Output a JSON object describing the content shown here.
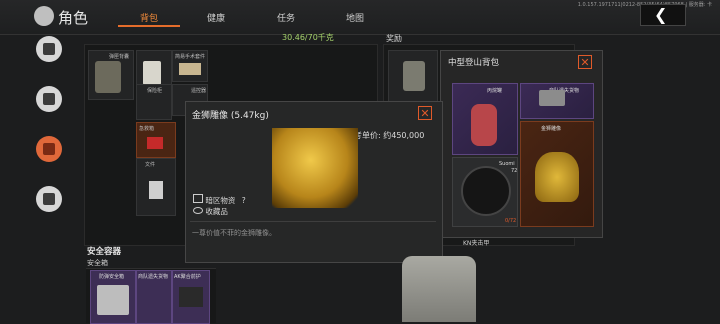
{
  "header": {
    "build": "1.0.157.1971711|0212-852|35(64)857968 | 服务器: 卡",
    "title": "角色",
    "tabs": [
      "背包",
      "健康",
      "任务",
      "地图"
    ],
    "active_tab": "背包"
  },
  "inventory": {
    "weight": "30.46/70千克",
    "items": [
      "弹匣背囊",
      "简易手术套件",
      "保险柜",
      "遥控器",
      "急救箱",
      "红色文件",
      "文件"
    ]
  },
  "reward": {
    "title": "奖励"
  },
  "bag_panel": {
    "title": "中型登山背包",
    "items": [
      "丙烷罐",
      "商队遗失货物",
      "Suomi",
      "金狮雕像"
    ],
    "suomi_sub": "72",
    "ammo": "0/72"
  },
  "popup": {
    "title": "金狮雕像 (5.47kg)",
    "price": "参考单价: 约450,000",
    "tag1": "暗区物资",
    "tag1_q": "?",
    "tag2": "收藏品",
    "desc": "一尊价值不菲的金狮雕像。"
  },
  "safe": {
    "title": "安全容器",
    "sub": "安全箱",
    "items": [
      "防弹安全箱",
      "商队遗失货物",
      "AK聚合前护"
    ]
  },
  "equip": {
    "kn": "KN夹击甲"
  },
  "colors": {
    "accent": "#e56d2b",
    "weight": "#a6d36c",
    "close": "#e05a2a"
  }
}
